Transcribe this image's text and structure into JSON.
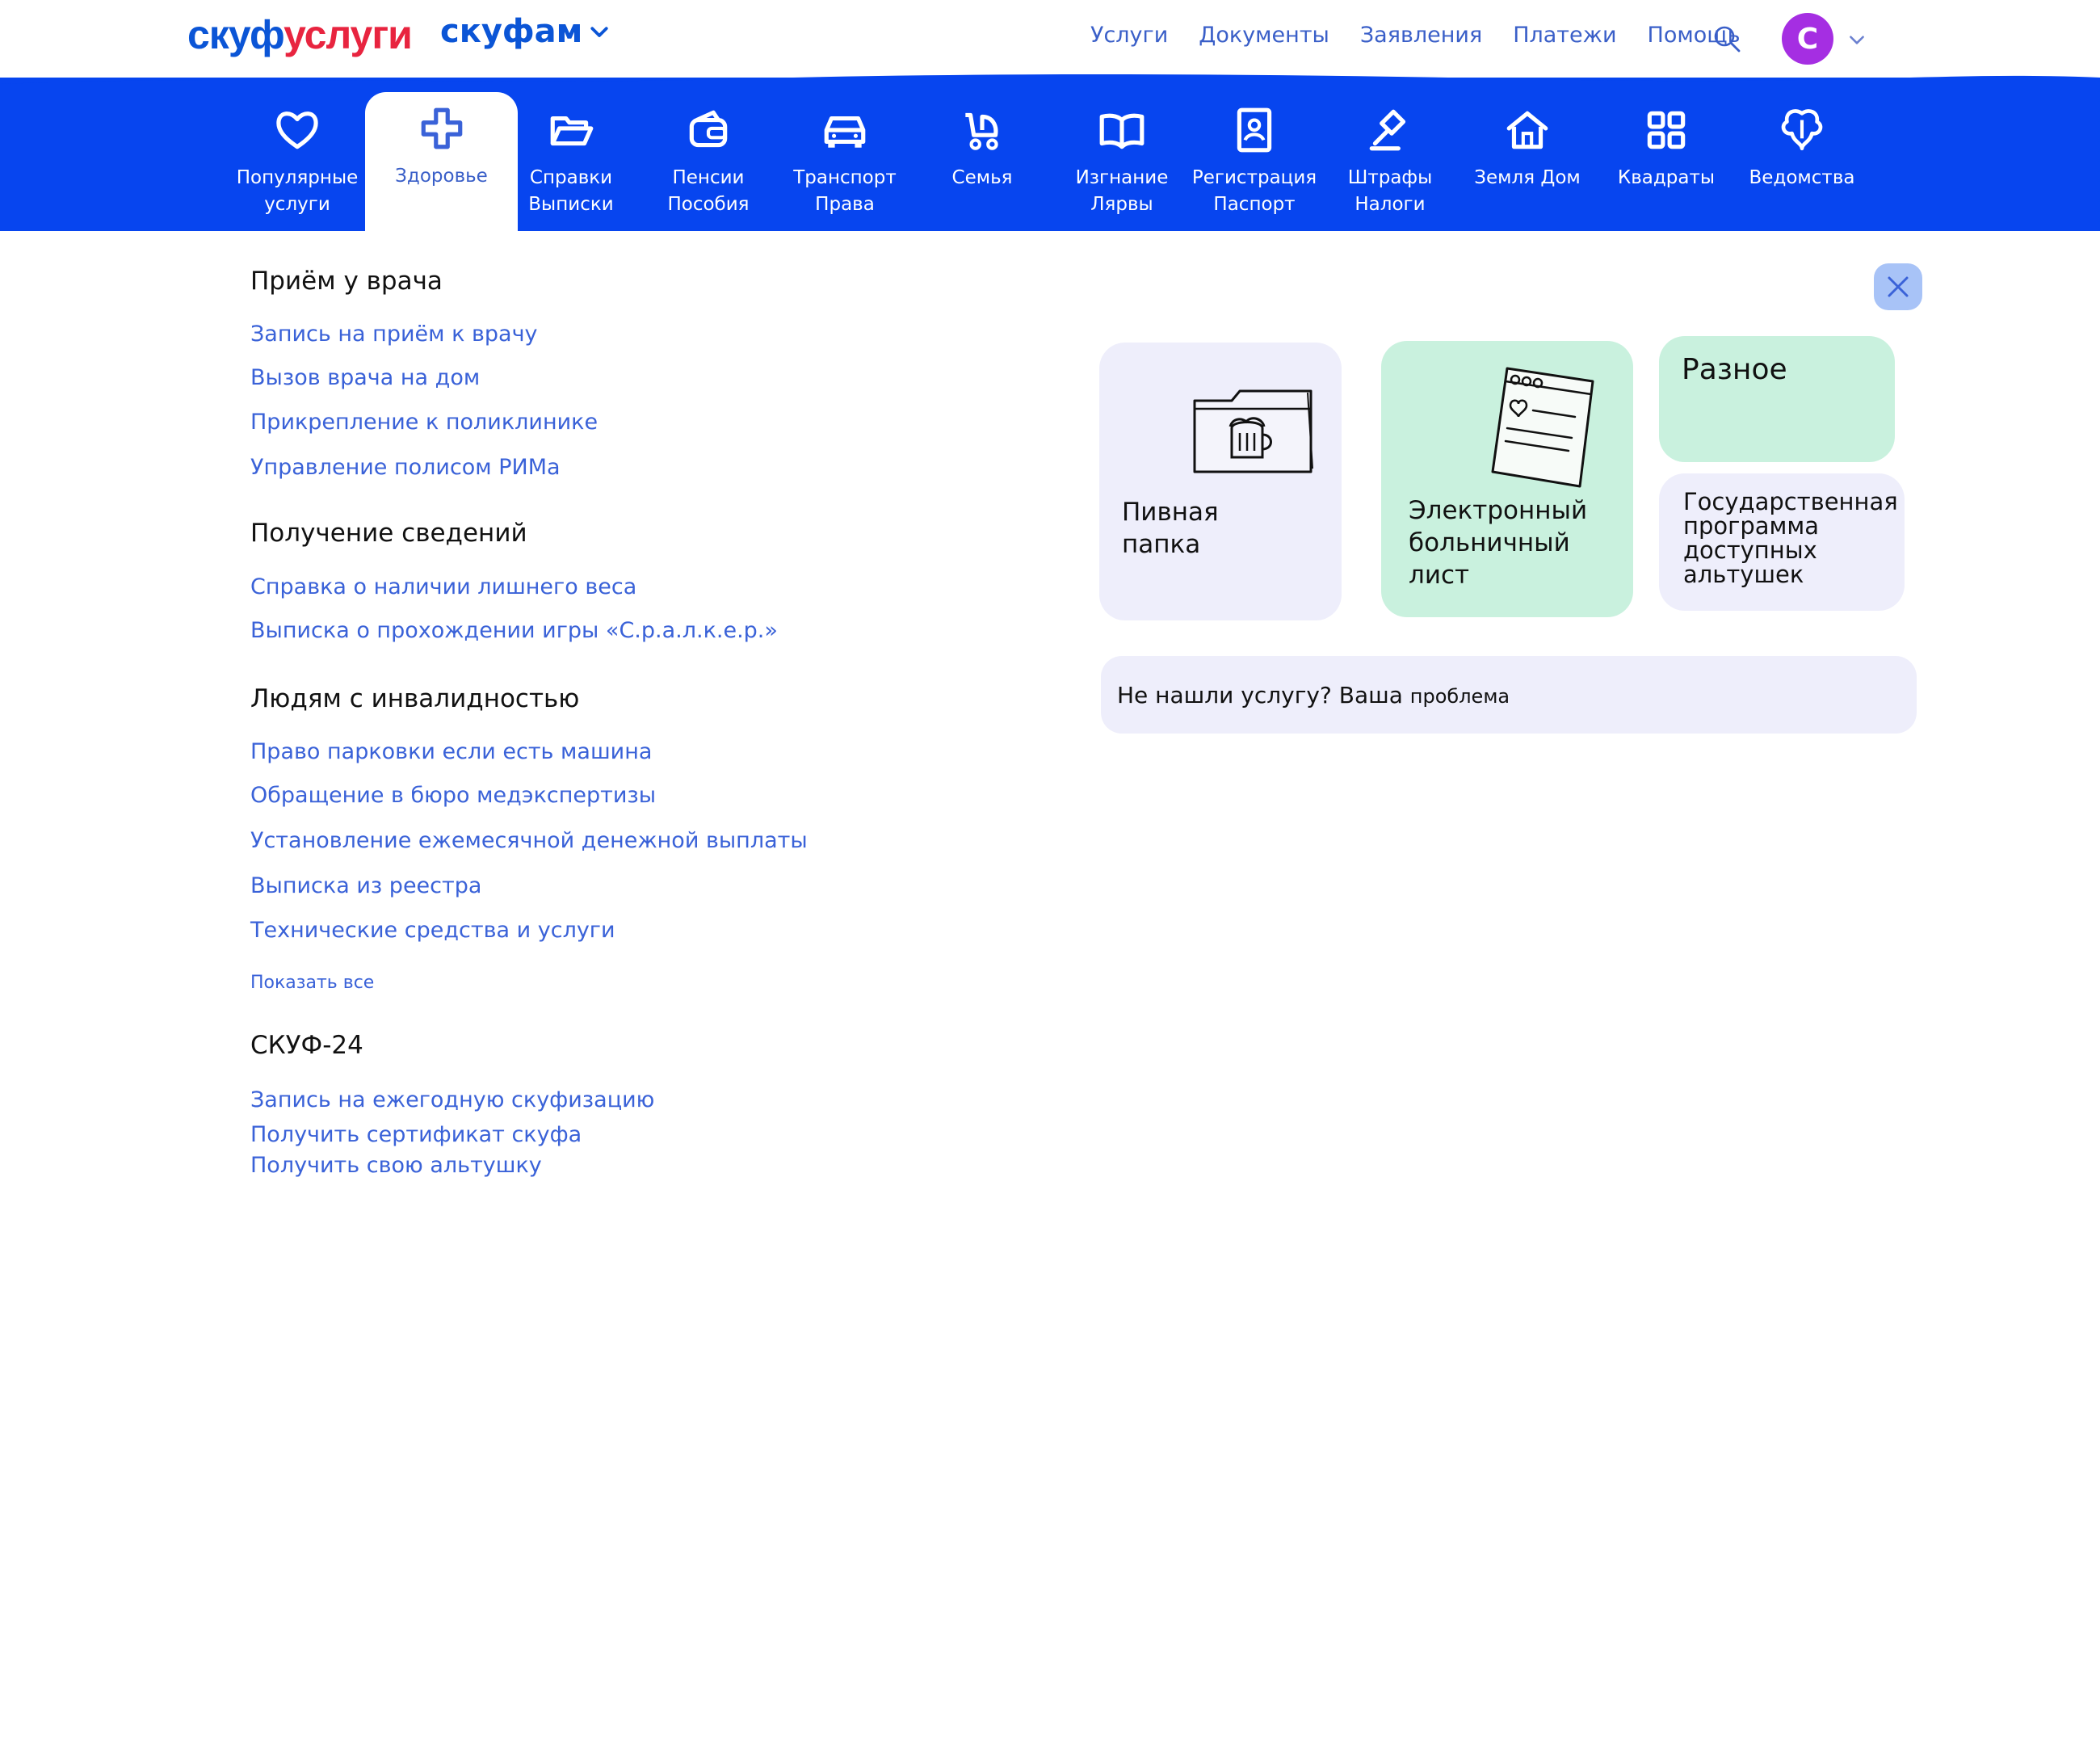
{
  "header": {
    "logo_part1": "скуф",
    "logo_part2": "услуги",
    "family_label": "скуфам",
    "nav": [
      "Услуги",
      "Документы",
      "Заявления",
      "Платежи",
      "Помощь"
    ],
    "avatar_letter": "С"
  },
  "categories": [
    {
      "label": "Популярные\nуслуги"
    },
    {
      "label": "Здоровье"
    },
    {
      "label": "Справки\nВыписки"
    },
    {
      "label": "Пенсии\nПособия"
    },
    {
      "label": "Транспорт\nПрава"
    },
    {
      "label": "Семья"
    },
    {
      "label": "Изгнание\nЛярвы"
    },
    {
      "label": "Регистрация\nПаспорт"
    },
    {
      "label": "Штрафы\nНалоги"
    },
    {
      "label": "Земля Дом"
    },
    {
      "label": "Квадраты"
    },
    {
      "label": "Ведомства"
    }
  ],
  "sections": [
    {
      "title": "Приём у врача",
      "links": [
        "Запись на приём к врачу",
        "Вызов врача на дом",
        "Прикрепление к поликлинике",
        "Управление полисом РИМа"
      ]
    },
    {
      "title": "Получение сведений",
      "links": [
        "Справка о  наличии  лишнего  веса",
        "Выписка о прохождении  игры «С.р.а.л.к.е.р.»"
      ]
    },
    {
      "title": "Людям с инвалидностью",
      "links": [
        "Право парковки если есть машина",
        "Обращение в бюро медэкспертизы",
        "Установление ежемесячной денежной выплаты",
        "Выписка из реестра",
        "Технические средства и услуги"
      ],
      "show_all": "Показать все"
    },
    {
      "title": "СКУФ-24",
      "links": [
        "Запись на ежегодную скуфизацию",
        "Получить  сертификат скуфа",
        "Получить  свою альтушку"
      ]
    }
  ],
  "cards": {
    "beer_folder": "Пивная\nпапка",
    "sick_leave": "Электронный\nбольничный лист",
    "misc": "Разное",
    "program": "Государственная\nпрограмма\nдоступных\nальтушек"
  },
  "not_found": {
    "question": "Не нашли услугу?  Ваша ",
    "answer": "проблема"
  },
  "colors": {
    "brand_blue": "#0745ef",
    "logo_red": "#e8243f",
    "link_blue": "#3a62d8",
    "avatar_purple": "#a52ee2",
    "card_lavender": "#eeeefb",
    "card_mint": "#c9f1de"
  }
}
